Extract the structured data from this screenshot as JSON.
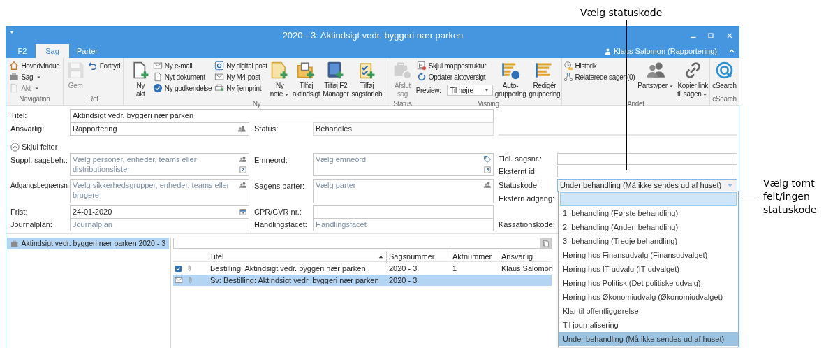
{
  "annotations": [
    {
      "text": "Vælg statuskode"
    },
    {
      "text": "Vælg tomt felt/ingen statuskode"
    }
  ],
  "window": {
    "title": "2020 - 3: Aktindsigt vedr. byggeri nær parken"
  },
  "ribbon": {
    "tabs": [
      {
        "label": "F2",
        "selected": false
      },
      {
        "label": "Sag",
        "selected": true
      },
      {
        "label": "Parter",
        "selected": false
      }
    ],
    "user_link": "Klaus Salomon (Rapportering)",
    "groups": [
      {
        "label": "Navigation",
        "items": [
          {
            "kind": "stack",
            "items": [
              {
                "kind": "small",
                "label": "Hovedvindue",
                "disabled": false,
                "menu": false
              },
              {
                "kind": "small",
                "label": "Sag",
                "disabled": false,
                "menu": true
              },
              {
                "kind": "small",
                "label": "Akt",
                "disabled": true,
                "menu": true
              }
            ]
          }
        ]
      },
      {
        "label": "Ret",
        "items": [
          {
            "kind": "large",
            "label": "Gem",
            "disabled": true,
            "menu": false
          },
          {
            "kind": "stack",
            "items": [
              {
                "kind": "small",
                "label": "Fortryd",
                "disabled": false,
                "menu": false
              }
            ]
          }
        ]
      },
      {
        "label": "Ny",
        "items": [
          {
            "kind": "large",
            "label": "Ny\nakt",
            "disabled": false,
            "menu": false
          },
          {
            "kind": "stack",
            "items": [
              {
                "kind": "small",
                "label": "Ny e-mail",
                "disabled": false,
                "menu": false
              },
              {
                "kind": "small",
                "label": "Nyt dokument",
                "disabled": false,
                "menu": false
              },
              {
                "kind": "small",
                "label": "Ny godkendelse",
                "disabled": false,
                "menu": false
              }
            ]
          },
          {
            "kind": "stack",
            "items": [
              {
                "kind": "small",
                "label": "Ny digital post",
                "disabled": false,
                "menu": false
              },
              {
                "kind": "small",
                "label": "Ny M4-post",
                "disabled": false,
                "menu": false
              },
              {
                "kind": "small",
                "label": "Ny fjernprint",
                "disabled": false,
                "menu": false
              }
            ]
          },
          {
            "kind": "large",
            "label": "Ny\nnote",
            "disabled": false,
            "menu": true
          },
          {
            "kind": "large",
            "label": "Tilføj\naktindsigt",
            "disabled": false,
            "menu": false
          },
          {
            "kind": "large",
            "label": "Tilføj F2\nManager",
            "disabled": false,
            "menu": false
          },
          {
            "kind": "large",
            "label": "Tilføj\nsagsforløb",
            "disabled": false,
            "menu": false
          }
        ]
      },
      {
        "label": "Status",
        "items": [
          {
            "kind": "large",
            "label": "Afslut\nsag",
            "disabled": true,
            "menu": false
          }
        ]
      },
      {
        "label": "Visning",
        "items": [
          {
            "kind": "stack",
            "items": [
              {
                "kind": "small",
                "label": "Skjul mappestruktur",
                "disabled": false,
                "menu": false
              },
              {
                "kind": "small",
                "label": "Opdater aktoversigt",
                "disabled": false,
                "menu": false
              },
              {
                "kind": "select",
                "label": "Preview:",
                "value": "Til højre"
              }
            ]
          },
          {
            "kind": "large",
            "label": "Auto-\ngruppering",
            "disabled": false,
            "menu": false
          },
          {
            "kind": "large",
            "label": "Redigér\ngruppering",
            "disabled": false,
            "menu": false
          }
        ]
      },
      {
        "label": "Andet",
        "items": [
          {
            "kind": "stack",
            "items": [
              {
                "kind": "small",
                "label": "Historik",
                "disabled": false,
                "menu": false
              },
              {
                "kind": "small",
                "label": "Relaterede sager (0)",
                "disabled": false,
                "menu": false
              }
            ]
          },
          {
            "kind": "large",
            "label": "Partstyper",
            "disabled": false,
            "menu": true
          },
          {
            "kind": "large",
            "label": "Kopier link\ntil sagen",
            "disabled": false,
            "menu": true
          }
        ]
      },
      {
        "label": "cSearch",
        "items": [
          {
            "kind": "large",
            "label": "cSearch",
            "disabled": false,
            "menu": false
          }
        ]
      }
    ]
  },
  "form": {
    "title_field": {
      "label": "Titel:",
      "value": "Aktindsigt vedr. byggeri nær parken"
    },
    "responsible": {
      "label": "Ansvarlig:",
      "value": "Rapportering"
    },
    "status": {
      "label": "Status:",
      "value": "Behandles"
    },
    "toggle": {
      "label": "Skjul felter",
      "expanded": true
    },
    "suppl": {
      "label": "Suppl. sagsbeh.:",
      "placeholder": "Vælg personer, enheder, teams eller distributionslister"
    },
    "keywords": {
      "label": "Emneord:",
      "placeholder": "Vælg emneord"
    },
    "prev_case_no": {
      "label": "Tidl. sagsnr.:"
    },
    "external_id": {
      "label": "Eksternt id:"
    },
    "access": {
      "label": "Adgangsbegrænsni",
      "placeholder": "Vælg sikkerhedsgrupper, enheder, teams eller brugere"
    },
    "parties": {
      "label": "Sagens parter:",
      "placeholder": "Vælg parter"
    },
    "status_code": {
      "label": "Statuskode:",
      "value": "Under behandling (Må ikke sendes ud af huset)",
      "open": true
    },
    "external_access": {
      "label": "Ekstern adgang:"
    },
    "deadline": {
      "label": "Frist:",
      "value": "24-01-2020"
    },
    "cpr": {
      "label": "CPR/CVR nr.:"
    },
    "journal_plan": {
      "label": "Journalplan:",
      "placeholder": "Journalplan"
    },
    "action_facet": {
      "label": "Handlingsfacet:",
      "placeholder": "Handlingsfacet"
    },
    "disposal_code": {
      "label": "Kassationskode:"
    }
  },
  "status_options": [
    {
      "kind": "blank",
      "selected": false,
      "hovered": true
    },
    {
      "kind": "text",
      "label": "1. behandling (Første behandling)",
      "selected": false,
      "hovered": false
    },
    {
      "kind": "text",
      "label": "2. behandling (Anden behandling)",
      "selected": false,
      "hovered": false
    },
    {
      "kind": "text",
      "label": "3. behandling (Tredje behandling)",
      "selected": false,
      "hovered": false
    },
    {
      "kind": "text",
      "label": "Høring hos Finansudvalg (Finansudvalget)",
      "selected": false,
      "hovered": false
    },
    {
      "kind": "text",
      "label": "Høring hos IT-udvalg (IT-udvalget)",
      "selected": false,
      "hovered": false
    },
    {
      "kind": "text",
      "label": "Høring hos Politisk (Det politiske udvalg)",
      "selected": false,
      "hovered": false
    },
    {
      "kind": "text",
      "label": "Høring hos Økonomiudvalg (Økonomiudvalget)",
      "selected": false,
      "hovered": false
    },
    {
      "kind": "text",
      "label": "Klar til offentliggørelse",
      "selected": false,
      "hovered": false
    },
    {
      "kind": "text",
      "label": "Til journalisering",
      "selected": false,
      "hovered": false
    },
    {
      "kind": "text",
      "label": "Under behandling (Må ikke sendes ud af huset)",
      "selected": true,
      "hovered": false
    }
  ],
  "tree": [
    {
      "label": "Aktindsigt vedr. byggeri nær parken 2020 - 3",
      "selected": true
    }
  ],
  "table": {
    "columns": [
      {
        "label": "Titel",
        "sorted": true
      },
      {
        "label": "Sagsnummer",
        "sorted": false
      },
      {
        "label": "Aktnummer",
        "sorted": false
      },
      {
        "label": "Ansvarlig",
        "sorted": false
      }
    ],
    "rows": [
      {
        "kind": "approval",
        "attachment": true,
        "selected": false,
        "cells": [
          "Bestilling: Aktindsigt vedr. byggeri nær parken",
          "2020 - 3",
          "1",
          "Klaus Salomon"
        ]
      },
      {
        "kind": "email",
        "attachment": true,
        "selected": true,
        "cells": [
          "Sv: Bestilling: Aktindsigt vedr. byggeri nær parken",
          "2020 - 3"
        ]
      }
    ]
  }
}
